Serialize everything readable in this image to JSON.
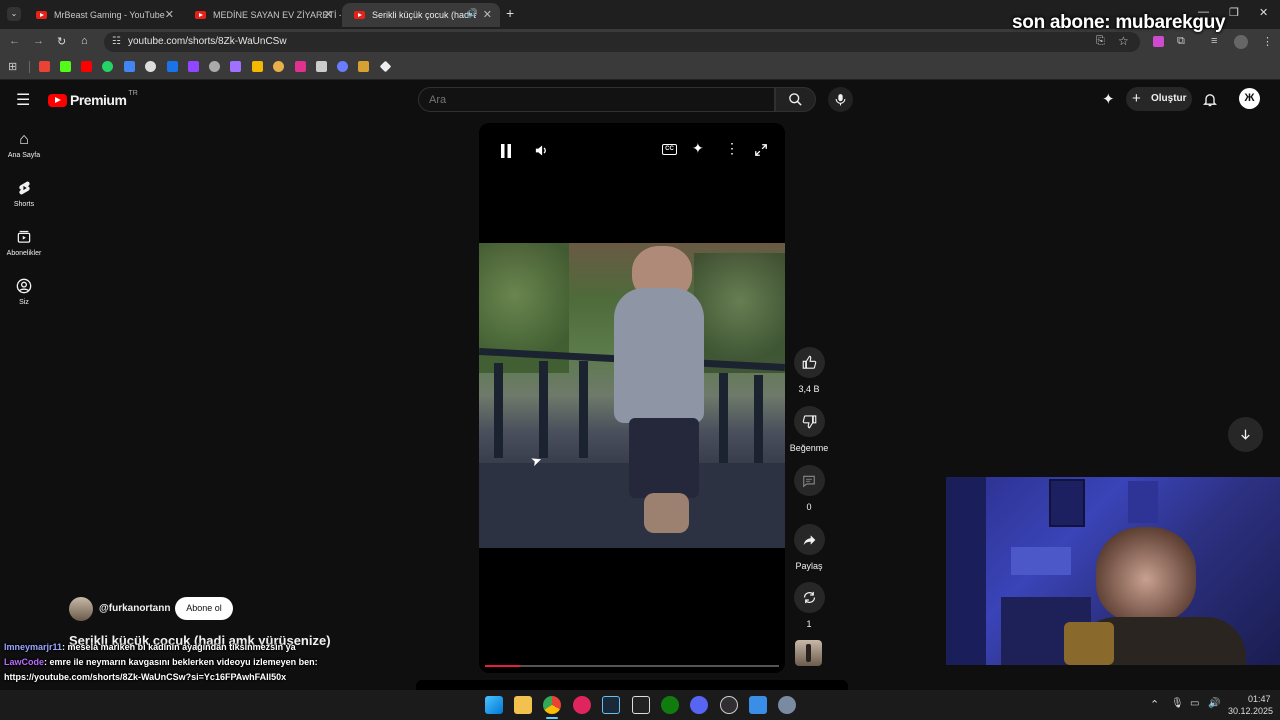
{
  "overlay": {
    "last_subscriber": "son abone: mubarekguy"
  },
  "tabs": [
    {
      "label": "MrBeast Gaming - YouTube"
    },
    {
      "label": "MEDİNE SAYAN EV ZİYARETİ - Y"
    },
    {
      "label": "Serikli küçük çocuk (hadi am"
    }
  ],
  "address": {
    "url": "youtube.com/shorts/8Zk-WaUnCSw"
  },
  "youtube": {
    "logo_label": "Premium",
    "region": "TR",
    "search_placeholder": "Ara",
    "create_label": "Oluştur",
    "sidebar": [
      {
        "label": "Ana Sayfa",
        "icon": "home-icon"
      },
      {
        "label": "Shorts",
        "icon": "shorts-icon"
      },
      {
        "label": "Abonelikler",
        "icon": "subscriptions-icon"
      },
      {
        "label": "Siz",
        "icon": "you-icon"
      }
    ]
  },
  "short": {
    "title": "Serikli küçük çocuk (hadi amk yürüsenize)",
    "channel": "@furkanortann",
    "subscribe_label": "Abone ol",
    "likes": "3,4 B",
    "dislike_label": "Beğenme",
    "comments": "0",
    "share_label": "Paylaş",
    "remix": "1",
    "progress_fraction": 0.12
  },
  "chat": [
    {
      "user": "lmneymarjr11",
      "user_color": "#9aa6ff",
      "text": ": mesela marikeh bi kadinin ayağından tiksinmezsin ya"
    },
    {
      "user": "LawCode",
      "user_color": "#b86bff",
      "text": ": emre ile neymarın kavgasını beklerken videoyu izlemeyen ben:"
    },
    {
      "user": "",
      "user_color": "#ffffff",
      "text": "https://youtube.com/shorts/8Zk-WaUnCSw?si=Yc16FPAwhFAIl50x"
    }
  ],
  "taskbar": {
    "time": "01:47",
    "date": "30.12.2025"
  },
  "colors": {
    "accent_red": "#e91e3c",
    "yt_red": "#ff0000",
    "bg": "#0f0f0f"
  }
}
